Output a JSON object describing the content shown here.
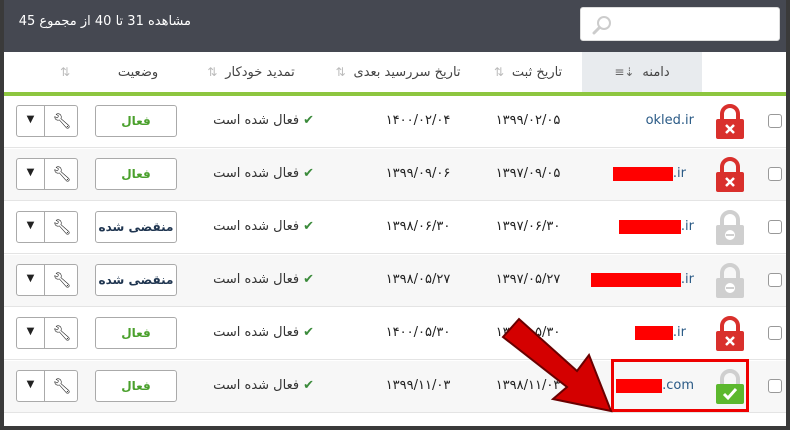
{
  "summary": "مشاهده 31 تا 40 از مجموع 45",
  "search": {
    "placeholder": ""
  },
  "headers": {
    "domain": "دامنه",
    "registration": "تاریخ ثبت",
    "expiration": "تاریخ سررسید بعدی",
    "auto_renew": "تمدید خودکار",
    "status": "وضعیت"
  },
  "rows": [
    {
      "domain_prefix": "",
      "domain_suffix": "okled.ir",
      "redacted": false,
      "lock": "red-locked",
      "reg": "۱۳۹۹/۰۲/۰۵",
      "exp": "۱۴۰۰/۰۲/۰۴",
      "auto": "فعال شده است",
      "status": "فعال",
      "status_type": "active"
    },
    {
      "domain_suffix": ".ir",
      "redacted": true,
      "lock": "red-locked",
      "reg": "۱۳۹۷/۰۹/۰۵",
      "exp": "۱۳۹۹/۰۹/۰۶",
      "auto": "فعال شده است",
      "status": "فعال",
      "status_type": "active"
    },
    {
      "domain_suffix": ".ir",
      "redacted": true,
      "lock": "gray",
      "reg": "۱۳۹۷/۰۶/۳۰",
      "exp": "۱۳۹۸/۰۶/۳۰",
      "auto": "فعال شده است",
      "status": "منقضی شده",
      "status_type": "expired"
    },
    {
      "domain_suffix": ".ir",
      "redacted": true,
      "lock": "gray",
      "reg": "۱۳۹۷/۰۵/۲۷",
      "exp": "۱۳۹۸/۰۵/۲۷",
      "auto": "فعال شده است",
      "status": "منقضی شده",
      "status_type": "expired"
    },
    {
      "domain_suffix": ".ir",
      "redacted": true,
      "lock": "red-locked",
      "reg": "۱۳۹۹/۰۵/۳۰",
      "exp": "۱۴۰۰/۰۵/۳۰",
      "auto": "فعال شده است",
      "status": "فعال",
      "status_type": "active"
    },
    {
      "domain_suffix": ".com",
      "redacted": true,
      "lock": "green-unlocked",
      "reg": "۱۳۹۸/۱۱/۰۳",
      "exp": "۱۳۹۹/۱۱/۰۳",
      "auto": "فعال شده است",
      "status": "فعال",
      "status_type": "active"
    }
  ],
  "colors": {
    "topbar": "#454851",
    "accent_green": "#8dc63f",
    "lock_red": "#d9302c",
    "lock_green": "#5cb82e",
    "highlight": "#ff0000"
  },
  "icons": {
    "search": "search-icon",
    "wrench": "wrench-icon",
    "caret": "caret-down-icon",
    "check": "check-icon",
    "sort": "sort-icon"
  }
}
